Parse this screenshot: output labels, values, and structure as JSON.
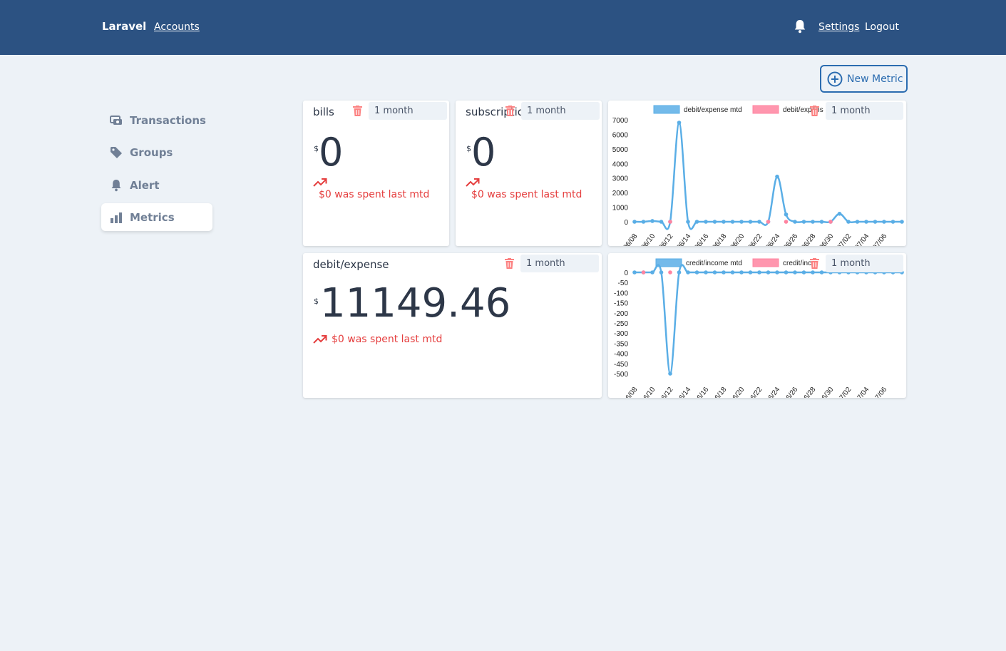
{
  "nav": {
    "brand": "Laravel",
    "accounts": "Accounts",
    "settings": "Settings",
    "logout": "Logout"
  },
  "new_metric_label": "New Metric",
  "sidebar": {
    "items": [
      {
        "label": "Transactions",
        "icon": "transactions-icon"
      },
      {
        "label": "Groups",
        "icon": "tag-icon"
      },
      {
        "label": "Alert",
        "icon": "bell-icon"
      },
      {
        "label": "Metrics",
        "icon": "bar-chart-icon",
        "active": true
      }
    ]
  },
  "cards": {
    "bills": {
      "title": "bills",
      "period": "1 month",
      "currency": "$",
      "value": "0",
      "note": "$0 was spent last mtd"
    },
    "subscriptions": {
      "title": "subscriptio",
      "period": "1 month",
      "currency": "$",
      "value": "0",
      "note": "$0 was spent last mtd"
    },
    "expense": {
      "title": "debit/expense",
      "period": "1 month",
      "currency": "$",
      "value": "11149.46",
      "note": "$0 was spent last mtd"
    }
  },
  "colors": {
    "accent": "#2b6cb0",
    "nav": "#2c5282",
    "series_blue": "#5aaee6",
    "series_pink": "#ff84a0",
    "alert_red": "#e53e3e"
  },
  "chart_data": [
    {
      "type": "line",
      "period": "1 month",
      "legend": [
        "debit/expense mtd",
        "debit/expens"
      ],
      "x_tick_labels": [
        "06/08",
        "06/10",
        "06/12",
        "06/14",
        "06/16",
        "06/18",
        "06/20",
        "06/22",
        "06/24",
        "06/26",
        "06/28",
        "06/30",
        "07/02",
        "07/04",
        "07/06"
      ],
      "y_ticks": [
        0,
        1000,
        2000,
        3000,
        4000,
        5000,
        6000,
        7000
      ],
      "ylim": [
        0,
        7000
      ],
      "series": [
        {
          "name": "debit/expense mtd",
          "color": "#5aaee6",
          "values": [
            0,
            0,
            50,
            0,
            0,
            6800,
            0,
            0,
            0,
            0,
            0,
            0,
            0,
            0,
            0,
            0,
            3100,
            500,
            0,
            0,
            0,
            0,
            0,
            550,
            0,
            0,
            0,
            0,
            0,
            0,
            0
          ]
        },
        {
          "name": "debit/expens",
          "color": "#ff84a0",
          "values": [
            null,
            null,
            null,
            null,
            0,
            null,
            null,
            null,
            null,
            null,
            null,
            null,
            null,
            null,
            null,
            0,
            null,
            0,
            null,
            null,
            null,
            null,
            0,
            null,
            null,
            null,
            null,
            null,
            null,
            null,
            null
          ]
        }
      ]
    },
    {
      "type": "line",
      "period": "1 month",
      "legend": [
        "credit/income mtd",
        "credit/inc"
      ],
      "x_tick_labels": [
        "06/08",
        "06/10",
        "06/12",
        "06/14",
        "06/16",
        "06/18",
        "06/20",
        "06/22",
        "06/24",
        "06/26",
        "06/28",
        "06/30",
        "07/02",
        "07/04",
        "07/06"
      ],
      "y_ticks": [
        0,
        -50,
        -100,
        -150,
        -200,
        -250,
        -300,
        -350,
        -400,
        -450,
        -500
      ],
      "ylim": [
        -500,
        0
      ],
      "series": [
        {
          "name": "credit/income mtd",
          "color": "#5aaee6",
          "values": [
            0,
            0,
            0,
            0,
            -500,
            0,
            0,
            0,
            0,
            0,
            0,
            0,
            0,
            0,
            0,
            0,
            0,
            0,
            0,
            0,
            0,
            0,
            0,
            0,
            0,
            0,
            0,
            0,
            0,
            0,
            0
          ]
        },
        {
          "name": "credit/inc",
          "color": "#ff84a0",
          "values": [
            null,
            0,
            null,
            null,
            0,
            null,
            null,
            null,
            null,
            null,
            null,
            null,
            null,
            null,
            null,
            null,
            null,
            null,
            null,
            null,
            null,
            null,
            null,
            null,
            null,
            null,
            null,
            null,
            null,
            null,
            null
          ]
        }
      ]
    }
  ]
}
